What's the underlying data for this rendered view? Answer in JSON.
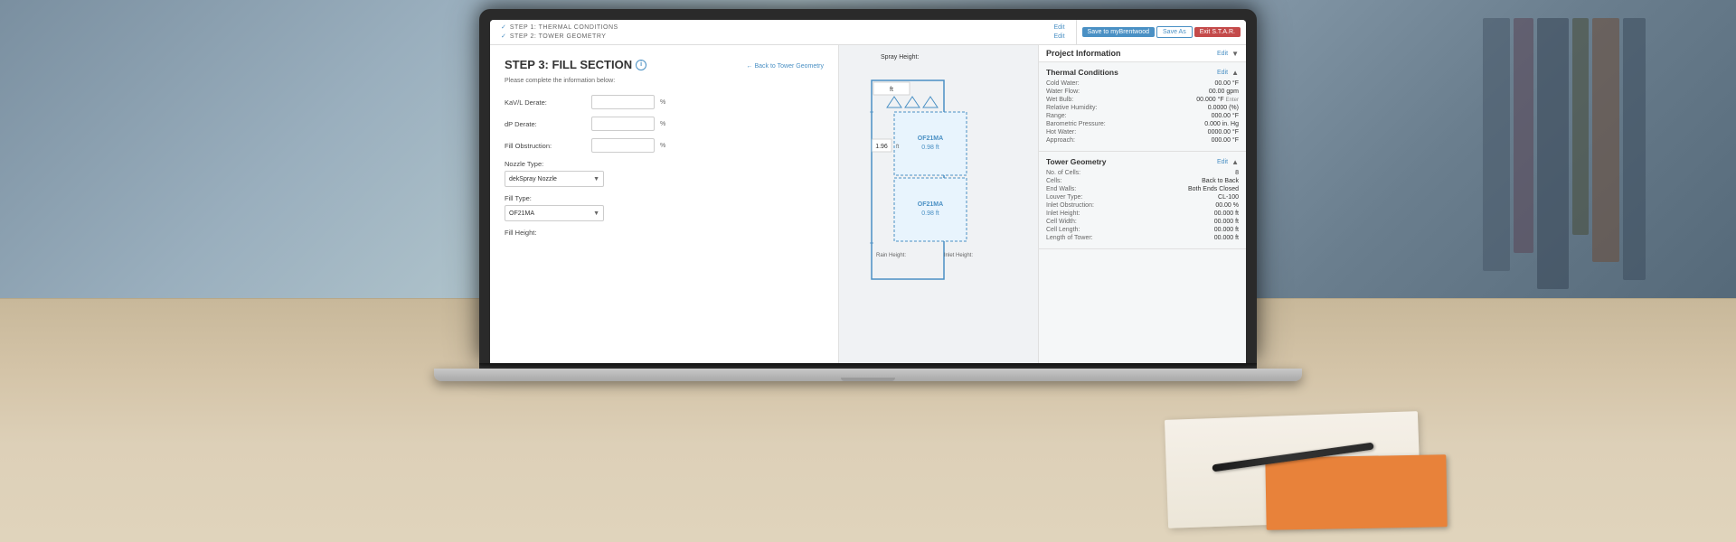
{
  "background": {
    "color": "#7a8fa0"
  },
  "laptop": {
    "screen": {
      "nav": {
        "step1_check": "✓",
        "step1_label": "STEP 1:   THERMAL CONDITIONS",
        "step1_edit": "Edit",
        "step2_check": "✓",
        "step2_label": "STEP 2:   TOWER GEOMETRY",
        "step2_edit": "Edit",
        "btn_save_mybrentwood": "Save to myBrentwood",
        "btn_save_as": "Save As",
        "btn_exit": "Exit S.T.A.R."
      },
      "left_panel": {
        "title": "STEP 3: FILL SECTION",
        "subtitle": "Please complete the information below:",
        "back_link": "← Back to Tower Geometry",
        "fields": [
          {
            "label": "KaV/L Derate:",
            "value": "",
            "unit": "%"
          },
          {
            "label": "dP Derate:",
            "value": "",
            "unit": "%"
          },
          {
            "label": "Fill Obstruction:",
            "value": "",
            "unit": "%"
          }
        ],
        "nozzle_label": "Nozzle Type:",
        "nozzle_value": "dekSpray Nozzle",
        "fill_type_label": "Fill Type:",
        "fill_type_value": "OF21MA",
        "fill_height_label": "Fill Height:",
        "diagram": {
          "spray_height_label": "Spray Height:",
          "spray_height_unit": "ft",
          "fill_label1": "OF21MA",
          "fill_value1": "0.98 ft",
          "fill_height_input": "1.96",
          "fill_height_unit": "ft",
          "fill_label2": "OF21MA",
          "fill_value2": "0.98 ft",
          "rain_height_label": "Rain Height:",
          "inlet_height_label": "Inlet Height:"
        }
      },
      "right_panel": {
        "project_info_title": "Project Information",
        "project_info_edit": "Edit",
        "thermal_conditions": {
          "title": "Thermal Conditions",
          "edit": "Edit",
          "fields": [
            {
              "key": "Cold Water:",
              "value": "00.00 °F"
            },
            {
              "key": "Water Flow:",
              "value": "00.00 gpm"
            },
            {
              "key": "Wet Bulb:",
              "value": "00.000 °F",
              "note": "Enter"
            },
            {
              "key": "Relative Humidity:",
              "value": "0.0000 (%)"
            },
            {
              "key": "Range:",
              "value": "000.00 °F"
            },
            {
              "key": "Barometric Pressure:",
              "value": "0.000 in. Hg"
            },
            {
              "key": "Hot Water:",
              "value": "0000.00 °F"
            },
            {
              "key": "Approach:",
              "value": "000.00 °F"
            }
          ]
        },
        "tower_geometry": {
          "title": "Tower Geometry",
          "edit": "Edit",
          "fields": [
            {
              "key": "No. of Cells:",
              "value": "8"
            },
            {
              "key": "Cells:",
              "value": "Back to Back"
            },
            {
              "key": "End Walls:",
              "value": "Both Ends Closed"
            },
            {
              "key": "Louver Type:",
              "value": "CL-100"
            },
            {
              "key": "Inlet Obstruction:",
              "value": "00.00 %"
            },
            {
              "key": "Inlet Height:",
              "value": "00.000 ft"
            },
            {
              "key": "Cell Width:",
              "value": "00.000 ft"
            },
            {
              "key": "Cell Length:",
              "value": "00.000 ft"
            },
            {
              "key": "Length of Tower:",
              "value": "00.000 ft"
            }
          ]
        }
      }
    }
  }
}
